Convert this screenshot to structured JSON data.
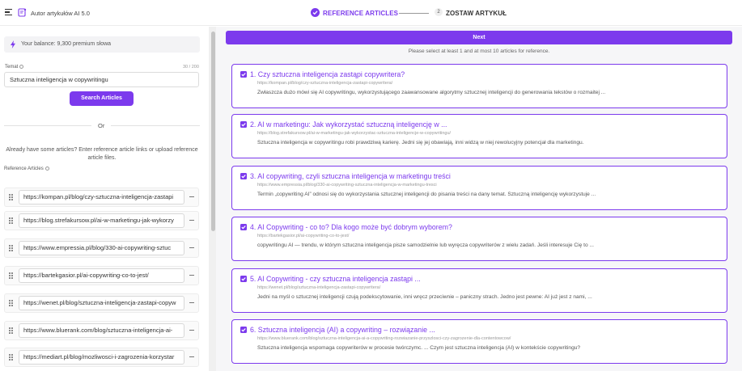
{
  "header": {
    "app_title": "Autor artykułów AI 5.0",
    "step1_label": "REFERENCE ARTICLES",
    "step2_number": "2",
    "step2_label": "ZOSTAW ARTYKUŁ"
  },
  "left": {
    "balance": "Your balance: 9,300 premium słowa",
    "topic_label": "Temat",
    "topic_count": "30 / 200",
    "topic_value": "Sztuczna inteligencja w copywritingu",
    "search_button": "Search Articles",
    "or_text": "Or",
    "already_text": "Already have some articles? Enter reference article links or upload reference article files.",
    "reference_label": "Reference Articles",
    "reference_links": [
      "https://kompan.pl/blog/czy-sztuczna-inteligencja-zastapi",
      "https://blog.strefakursow.pl/ai-w-marketingu-jak-wykorzy",
      "https://www.empressia.pl/blog/330-ai-copywriting-sztuc",
      "https://bartekgasior.pl/ai-copywriting-co-to-jest/",
      "https://wenet.pl/blog/sztuczna-inteligencja-zastapi-copyw",
      "https://www.bluerank.com/blog/sztuczna-inteligencja-ai-",
      "https://mediart.pl/blog/mozliwosci-i-zagrozenia-korzystar"
    ]
  },
  "right": {
    "next_button": "Next",
    "select_note": "Please select at least 1 and at most 10 articles for reference.",
    "articles": [
      {
        "title": "1. Czy sztuczna inteligencja zastąpi copywritera?",
        "url": "https://kompan.pl/blog/czy-sztuczna-inteligencja-zastapi-copywritera/",
        "desc": "Zwłaszcza dużo mówi się AI copywritingu, wykorzystującego zaawansowane algorytmy sztucznej inteligencji do generowania tekstów o rozmaitej ..."
      },
      {
        "title": "2. AI w marketingu: Jak wykorzystać sztuczną inteligencję w ...",
        "url": "https://blog.strefakursow.pl/ai-w-marketingu-jak-wykorzystac-sztuczna-inteligencje-w-copywritingu/",
        "desc": "Sztuczna inteligencja w copywritingu robi prawdziwą karierę. Jedni się jej obawiają, inni widzą w niej rewolucyjny potencjał dla marketingu."
      },
      {
        "title": "3. AI copywriting, czyli sztuczna inteligencja w marketingu treści",
        "url": "https://www.empressia.pl/blog/330-ai-copywriting-sztuczna-inteligencja-w-marketingu-tresci",
        "desc": "Termin „copywriting AI” odnosi się do wykorzystania sztucznej inteligencji do pisania treści na dany temat. Sztuczną inteligencję wykorzystuje ..."
      },
      {
        "title": "4. AI Copywriting - co to? Dla kogo może być dobrym wyborem?",
        "url": "https://bartekgasior.pl/ai-copywriting-co-to-jest/",
        "desc": "copywritingu AI — trendu, w którym sztuczna inteligencja pisze samodzielnie lub wyręcza copywriterów z wielu zadań. Jeśli interesuje Cię to ..."
      },
      {
        "title": "5. AI Copywriting - czy sztuczna inteligencja zastąpi ...",
        "url": "https://wenet.pl/blog/sztuczna-inteligencja-zastapi-copywritera/",
        "desc": "Jedni na myśl o sztucznej inteligencji czują podekscytowanie, inni wręcz przeciwnie – paniczny strach. Jedno jest pewne: AI już jest z nami, ..."
      },
      {
        "title": "6. Sztuczna inteligencja (AI) a copywriting – rozwiązanie ...",
        "url": "https://www.bluerank.com/blog/sztuczna-inteligencja-ai-a-copywriting-rozwiazanie-przyszlosci-czy-zagrozenie-dla-contentowcow/",
        "desc": "Sztuczna inteligencja wspomaga copywriterów w procesie twórczymc. ... Czym jest sztuczna inteligencja (AI) w kontekście copywritingu?"
      }
    ]
  },
  "colors": {
    "accent": "#7c3aed"
  }
}
